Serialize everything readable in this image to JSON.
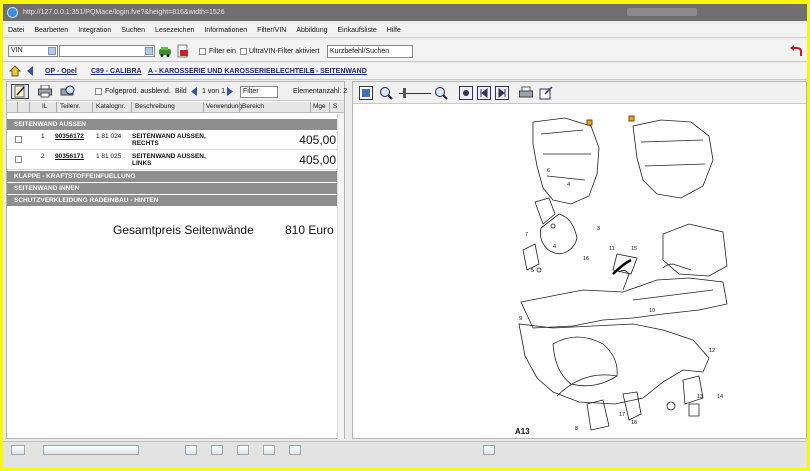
{
  "browser": {
    "url": "http://127.0.0.1:351/PQMace/login.fve?&height=816&width=1526"
  },
  "menu": [
    "Datei",
    "Bearbeiten",
    "Integration",
    "Suchen",
    "Lesezeichen",
    "Informationen",
    "Filter/VIN",
    "Abbildung",
    "Einkaufsliste",
    "Hilfe"
  ],
  "toolbar": {
    "vin_select": "VIN",
    "filter_label": "Filter ein",
    "ultravin_label": "UltraVIN-Filter aktiviert",
    "search_placeholder": "Kurzbefehl/Suchen"
  },
  "breadcrumb": [
    "OP - Opel",
    "C89 - CALIBRA",
    "A - KAROSSERIE UND KAROSSERIEBLECHTEILE",
    "6 - SEITENWAND"
  ],
  "left": {
    "folgeprod_label": "Folgeprod. ausblend.",
    "bild_label": "Bild",
    "page_of": "1 von 1",
    "filter_value": "Filter",
    "element_count": "Elementanzahl: 2",
    "columns": [
      "IL",
      "Teilenr.",
      "Katalognr.",
      "Beschreibung",
      "Verwendung",
      "Bereich",
      "Mge",
      "S"
    ],
    "group_top": "SEITENWAND AUSSEN",
    "rows": [
      {
        "il": "1",
        "part": "90356172",
        "catalog": "1 81 024",
        "desc1": "SEITENWAND AUSSEN,",
        "desc2": "RECHTS",
        "price": "405,00"
      },
      {
        "il": "2",
        "part": "90356171",
        "catalog": "1 81 025",
        "desc1": "SEITENWAND AUSSEN,",
        "desc2": "LINKS",
        "price": "405,00"
      }
    ],
    "groups_bottom": [
      "KLAPPE - KRAFTSTOFFEINFUELLUNG",
      "SEITENWAND INNEN",
      "SCHUTZVERKLEIDUNG RADEINBAU - HINTEN"
    ],
    "total_label": "Gesamtpreis Seitenwände",
    "total_value": "810 Euro"
  },
  "diagram": {
    "code": "A13",
    "callouts": [
      "1",
      "2",
      "3",
      "4",
      "5",
      "6",
      "7",
      "8",
      "9",
      "10",
      "11",
      "12",
      "13",
      "14",
      "15",
      "16",
      "17",
      "18"
    ]
  }
}
